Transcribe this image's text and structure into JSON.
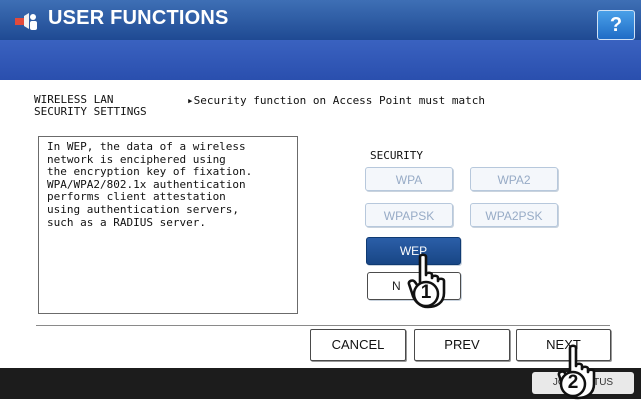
{
  "header": {
    "title": "USER FUNCTIONS",
    "help_label": "?"
  },
  "setting": {
    "label": "WIRELESS LAN\nSECURITY SETTINGS",
    "notice": "▸Security function on Access Point must match"
  },
  "description": "In WEP, the data of a wireless\nnetwork is enciphered using\nthe encryption key of fixation.\nWPA/WPA2/802.1x authentication\nperforms client attestation\nusing authentication servers,\nsuch as a RADIUS server.",
  "security": {
    "label": "SECURITY",
    "options": [
      "WPA",
      "WPA2",
      "WPAPSK",
      "WPA2PSK",
      "WEP",
      "NONE"
    ],
    "selected": "WEP",
    "none_visible_text": "N"
  },
  "buttons": {
    "cancel": "CANCEL",
    "prev": "PREV",
    "next": "NEXT"
  },
  "footer": {
    "job_status": "JOB STATUS"
  },
  "steps": [
    "1",
    "2"
  ],
  "colors": {
    "titlebar": "#2a5aa4",
    "selected": "#1f4f93",
    "accent": "#1f6cc6"
  }
}
